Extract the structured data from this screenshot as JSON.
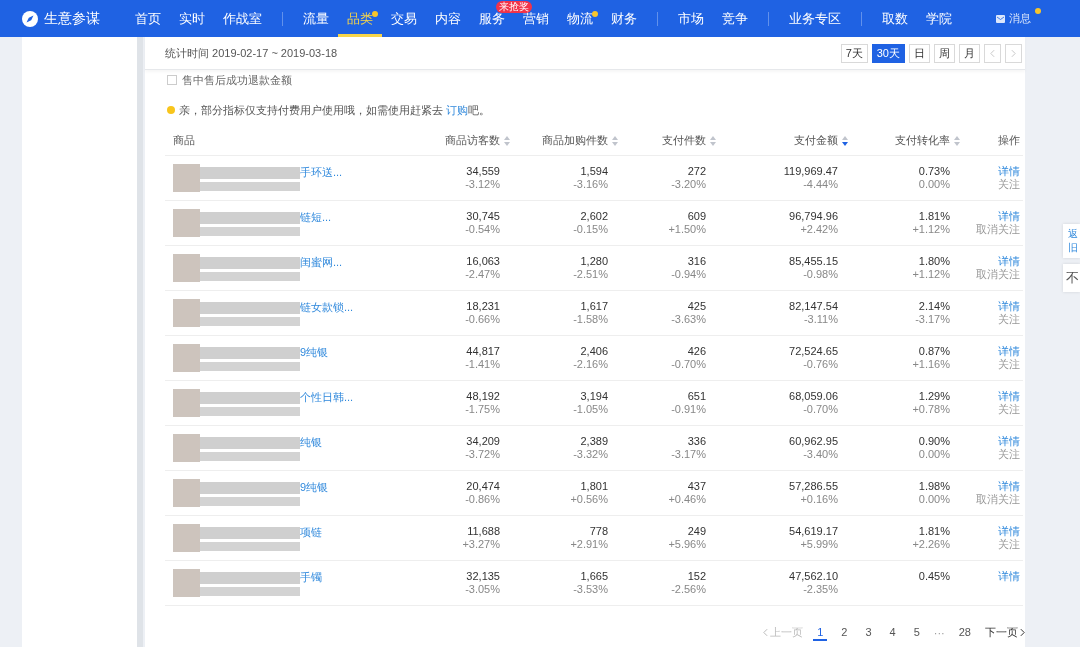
{
  "nav": {
    "brand": "生意参谋",
    "groups": [
      [
        {
          "label": "首页",
          "selected": false,
          "dot": false
        },
        {
          "label": "实时",
          "selected": false,
          "dot": false
        },
        {
          "label": "作战室",
          "selected": false,
          "dot": false
        }
      ],
      [
        {
          "label": "流量",
          "selected": false,
          "dot": false
        },
        {
          "label": "品类",
          "selected": true,
          "dot": true
        },
        {
          "label": "交易",
          "selected": false,
          "dot": false
        },
        {
          "label": "内容",
          "selected": false,
          "dot": false
        },
        {
          "label": "服务",
          "selected": false,
          "dot": false,
          "badge": "来抢奖"
        },
        {
          "label": "营销",
          "selected": false,
          "dot": false
        },
        {
          "label": "物流",
          "selected": false,
          "dot": true
        },
        {
          "label": "财务",
          "selected": false,
          "dot": false
        }
      ],
      [
        {
          "label": "市场",
          "selected": false,
          "dot": false
        },
        {
          "label": "竞争",
          "selected": false,
          "dot": false
        }
      ],
      [
        {
          "label": "业务专区",
          "selected": false,
          "dot": false
        }
      ],
      [
        {
          "label": "取数",
          "selected": false,
          "dot": false
        },
        {
          "label": "学院",
          "selected": false,
          "dot": false
        }
      ]
    ],
    "messages": {
      "label": "消息",
      "dot": true
    }
  },
  "header": {
    "date_range": "统计时间 2019-02-17 ~ 2019-03-18",
    "periods": [
      {
        "label": "7天",
        "selected": false
      },
      {
        "label": "30天",
        "selected": true
      },
      {
        "label": "日",
        "selected": false
      },
      {
        "label": "周",
        "selected": false
      },
      {
        "label": "月",
        "selected": false
      }
    ],
    "arrows": [
      {
        "kind": "prev",
        "disabled": true
      },
      {
        "kind": "next",
        "disabled": true
      }
    ]
  },
  "filter": {
    "label": "售中售后成功退款金额",
    "checked": false
  },
  "notice": {
    "text": "亲，部分指标仅支持付费用户使用哦，如需使用赶紧去 ",
    "link": "订购",
    "tail": "吧。"
  },
  "table": {
    "columns": [
      {
        "label": "商品"
      },
      {
        "label": "商品访客数",
        "sorted": false
      },
      {
        "label": "商品加购件数",
        "sorted": false
      },
      {
        "label": "支付件数",
        "sorted": false
      },
      {
        "label": "支付金额",
        "sorted": true
      },
      {
        "label": "支付转化率",
        "sorted": false
      },
      {
        "label": "操作"
      }
    ],
    "rows": [
      {
        "product": {
          "title": "手环送..."
        },
        "metrics": [
          {
            "value": "34,559",
            "change": "-3.12%"
          },
          {
            "value": "1,594",
            "change": "-3.16%"
          },
          {
            "value": "272",
            "change": "-3.20%"
          },
          {
            "value": "119,969.47",
            "change": "-4.44%"
          },
          {
            "value": "0.73%",
            "change": "0.00%"
          }
        ],
        "actions": [
          {
            "kind": "detail",
            "label": "详情"
          },
          {
            "kind": "follow",
            "label": "关注"
          }
        ]
      },
      {
        "product": {
          "title": "链短..."
        },
        "metrics": [
          {
            "value": "30,745",
            "change": "-0.54%"
          },
          {
            "value": "2,602",
            "change": "-0.15%"
          },
          {
            "value": "609",
            "change": "+1.50%"
          },
          {
            "value": "96,794.96",
            "change": "+2.42%"
          },
          {
            "value": "1.81%",
            "change": "+1.12%"
          }
        ],
        "actions": [
          {
            "kind": "detail",
            "label": "详情"
          },
          {
            "kind": "follow",
            "label": "取消关注"
          }
        ]
      },
      {
        "product": {
          "title": "闺蜜网..."
        },
        "metrics": [
          {
            "value": "16,063",
            "change": "-2.47%"
          },
          {
            "value": "1,280",
            "change": "-2.51%"
          },
          {
            "value": "316",
            "change": "-0.94%"
          },
          {
            "value": "85,455.15",
            "change": "-0.98%"
          },
          {
            "value": "1.80%",
            "change": "+1.12%"
          }
        ],
        "actions": [
          {
            "kind": "detail",
            "label": "详情"
          },
          {
            "kind": "follow",
            "label": "取消关注"
          }
        ]
      },
      {
        "product": {
          "title": "链女款锁..."
        },
        "metrics": [
          {
            "value": "18,231",
            "change": "-0.66%"
          },
          {
            "value": "1,617",
            "change": "-1.58%"
          },
          {
            "value": "425",
            "change": "-3.63%"
          },
          {
            "value": "82,147.54",
            "change": "-3.11%"
          },
          {
            "value": "2.14%",
            "change": "-3.17%"
          }
        ],
        "actions": [
          {
            "kind": "detail",
            "label": "详情"
          },
          {
            "kind": "follow",
            "label": "关注"
          }
        ]
      },
      {
        "product": {
          "title": "9纯银"
        },
        "metrics": [
          {
            "value": "44,817",
            "change": "-1.41%"
          },
          {
            "value": "2,406",
            "change": "-2.16%"
          },
          {
            "value": "426",
            "change": "-0.70%"
          },
          {
            "value": "72,524.65",
            "change": "-0.76%"
          },
          {
            "value": "0.87%",
            "change": "+1.16%"
          }
        ],
        "actions": [
          {
            "kind": "detail",
            "label": "详情"
          },
          {
            "kind": "follow",
            "label": "关注"
          }
        ]
      },
      {
        "product": {
          "title": "个性日韩..."
        },
        "metrics": [
          {
            "value": "48,192",
            "change": "-1.75%"
          },
          {
            "value": "3,194",
            "change": "-1.05%"
          },
          {
            "value": "651",
            "change": "-0.91%"
          },
          {
            "value": "68,059.06",
            "change": "-0.70%"
          },
          {
            "value": "1.29%",
            "change": "+0.78%"
          }
        ],
        "actions": [
          {
            "kind": "detail",
            "label": "详情"
          },
          {
            "kind": "follow",
            "label": "关注"
          }
        ]
      },
      {
        "product": {
          "title": "纯银"
        },
        "metrics": [
          {
            "value": "34,209",
            "change": "-3.72%"
          },
          {
            "value": "2,389",
            "change": "-3.32%"
          },
          {
            "value": "336",
            "change": "-3.17%"
          },
          {
            "value": "60,962.95",
            "change": "-3.40%"
          },
          {
            "value": "0.90%",
            "change": "0.00%"
          }
        ],
        "actions": [
          {
            "kind": "detail",
            "label": "详情"
          },
          {
            "kind": "follow",
            "label": "关注"
          }
        ]
      },
      {
        "product": {
          "title": "9纯银"
        },
        "metrics": [
          {
            "value": "20,474",
            "change": "-0.86%"
          },
          {
            "value": "1,801",
            "change": "+0.56%"
          },
          {
            "value": "437",
            "change": "+0.46%"
          },
          {
            "value": "57,286.55",
            "change": "+0.16%"
          },
          {
            "value": "1.98%",
            "change": "0.00%"
          }
        ],
        "actions": [
          {
            "kind": "detail",
            "label": "详情"
          },
          {
            "kind": "follow",
            "label": "取消关注"
          }
        ]
      },
      {
        "product": {
          "title": "项链"
        },
        "metrics": [
          {
            "value": "11,688",
            "change": "+3.27%"
          },
          {
            "value": "778",
            "change": "+2.91%"
          },
          {
            "value": "249",
            "change": "+5.96%"
          },
          {
            "value": "54,619.17",
            "change": "+5.99%"
          },
          {
            "value": "1.81%",
            "change": "+2.26%"
          }
        ],
        "actions": [
          {
            "kind": "detail",
            "label": "详情"
          },
          {
            "kind": "follow",
            "label": "关注"
          }
        ]
      },
      {
        "product": {
          "title": "手镯"
        },
        "metrics": [
          {
            "value": "32,135",
            "change": "-3.05%"
          },
          {
            "value": "1,665",
            "change": "-3.53%"
          },
          {
            "value": "152",
            "change": "-2.56%"
          },
          {
            "value": "47,562.10",
            "change": "-2.35%"
          },
          {
            "value": "0.45%"
          }
        ],
        "actions": [
          {
            "kind": "detail",
            "label": "详情"
          }
        ]
      }
    ]
  },
  "pagination": {
    "prev": {
      "label": "上一页",
      "disabled": true
    },
    "pages": [
      {
        "kind": "page",
        "label": "1",
        "selected": true
      },
      {
        "kind": "page",
        "label": "2",
        "selected": false
      },
      {
        "kind": "page",
        "label": "3",
        "selected": false
      },
      {
        "kind": "page",
        "label": "4",
        "selected": false
      },
      {
        "kind": "page",
        "label": "5",
        "selected": false
      },
      {
        "kind": "ellipsis",
        "label": "···"
      },
      {
        "kind": "page",
        "label": "28",
        "selected": false
      }
    ],
    "next": {
      "label": "下一页",
      "disabled": false
    }
  },
  "side_buttons": [
    {
      "kind": "link",
      "lines": [
        "返",
        "旧"
      ]
    },
    {
      "kind": "plain",
      "lines": [
        "不"
      ]
    }
  ]
}
